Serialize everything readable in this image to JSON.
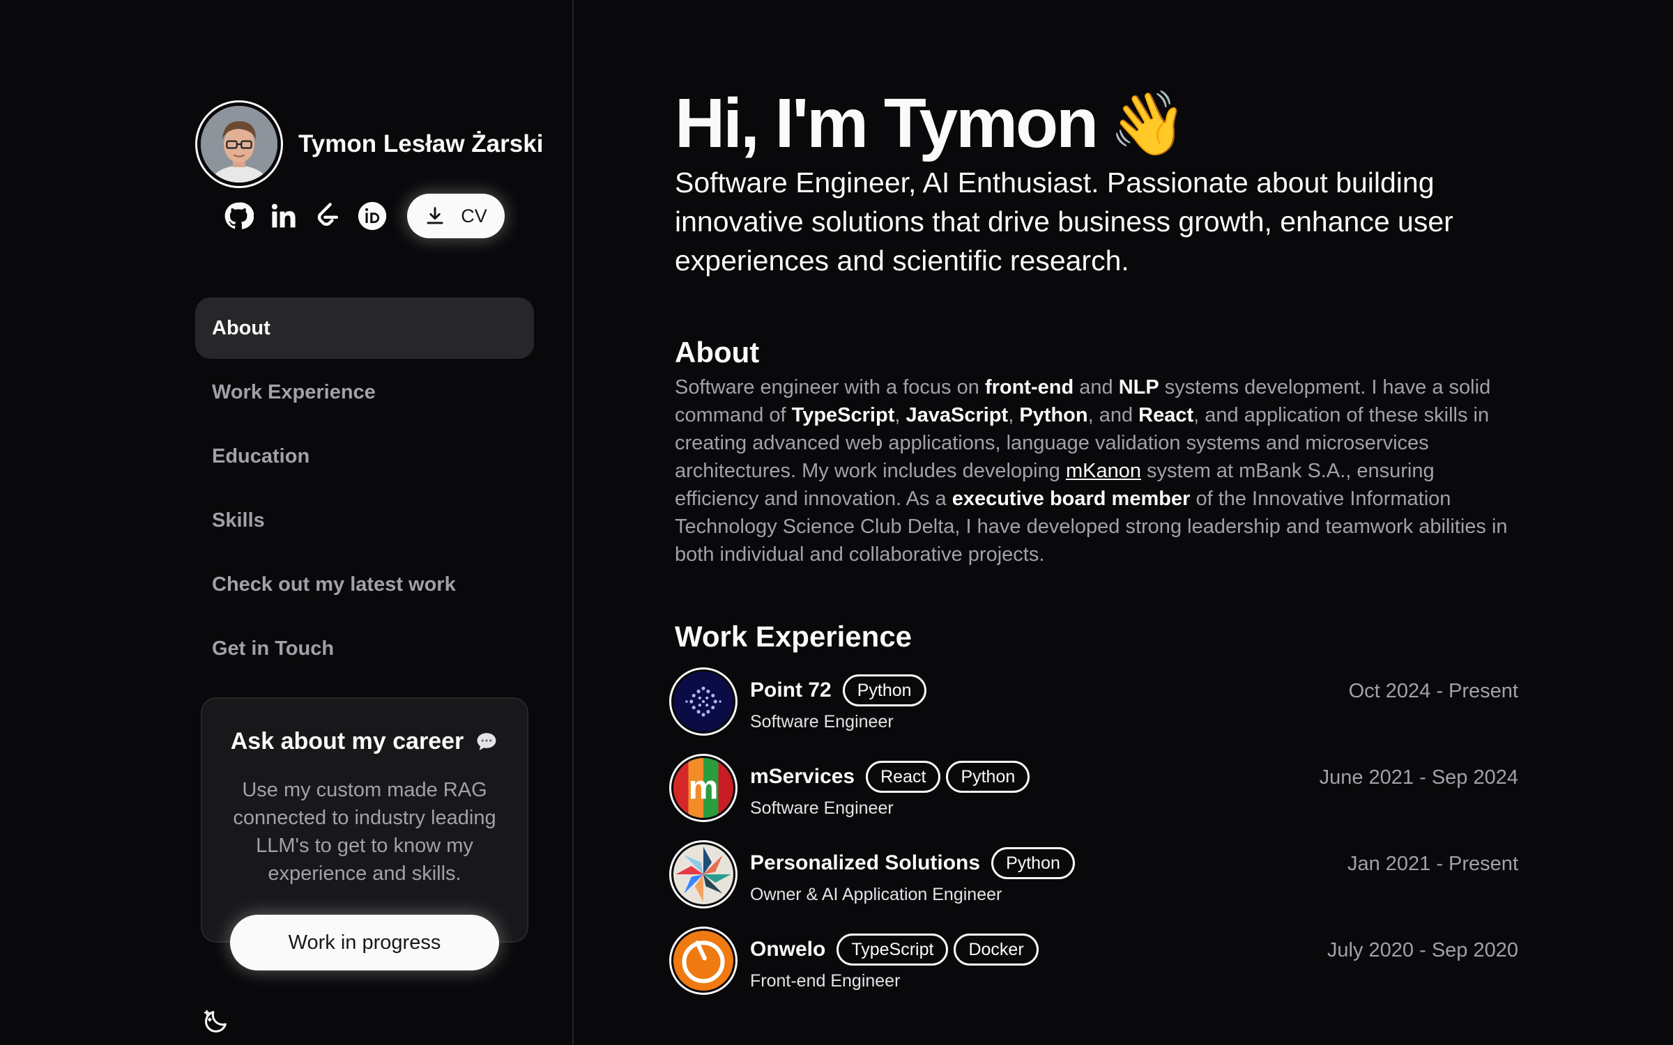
{
  "profile": {
    "name": "Tymon Lesław Żarski",
    "cv_label": "CV",
    "socials": [
      "github-icon",
      "linkedin-icon",
      "leetcode-icon",
      "orcid-icon"
    ]
  },
  "nav": {
    "items": [
      {
        "label": "About",
        "active": true
      },
      {
        "label": "Work Experience",
        "active": false
      },
      {
        "label": "Education",
        "active": false
      },
      {
        "label": "Skills",
        "active": false
      },
      {
        "label": "Check out my latest work",
        "active": false
      },
      {
        "label": "Get in Touch",
        "active": false
      }
    ]
  },
  "career_card": {
    "title": "Ask about my career",
    "text": "Use my custom made RAG connected to industry leading LLM's to get to know my experience and skills.",
    "button": "Work in progress"
  },
  "hero": {
    "title": "Hi, I'm Tymon",
    "wave": "👋",
    "subtitle": "Software Engineer, AI Enthusiast. Passionate about building innovative solutions that drive business growth, enhance user experiences and scientific research."
  },
  "about": {
    "heading": "About",
    "parts": [
      {
        "t": "Software engineer with a focus on "
      },
      {
        "t": "front-end",
        "b": true
      },
      {
        "t": " and "
      },
      {
        "t": "NLP",
        "b": true
      },
      {
        "t": " systems development. I have a solid command of "
      },
      {
        "t": "TypeScript",
        "b": true
      },
      {
        "t": ", "
      },
      {
        "t": "JavaScript",
        "b": true
      },
      {
        "t": ", "
      },
      {
        "t": "Python",
        "b": true
      },
      {
        "t": ", and "
      },
      {
        "t": "React",
        "b": true
      },
      {
        "t": ", and application of these skills in creating advanced web applications, language validation systems and microservices architectures. My work includes developing "
      },
      {
        "t": "mKanon",
        "link": true
      },
      {
        "t": " system at mBank S.A., ensuring efficiency and innovation. As a "
      },
      {
        "t": "executive board member",
        "b": true
      },
      {
        "t": " of the Innovative Information Technology Science Club Delta, I have developed strong leadership and teamwork abilities in both individual and collaborative projects."
      }
    ]
  },
  "work": {
    "heading": "Work Experience",
    "jobs": [
      {
        "company": "Point 72",
        "tags": [
          "Python"
        ],
        "role": "Software Engineer",
        "date": "Oct 2024  -  Present",
        "logo": "point72-logo"
      },
      {
        "company": "mServices",
        "tags": [
          "React",
          "Python"
        ],
        "role": "Software Engineer",
        "date": "June 2021  -  Sep 2024",
        "logo": "mservices-logo"
      },
      {
        "company": "Personalized Solutions",
        "tags": [
          "Python"
        ],
        "role": "Owner & AI Application Engineer",
        "date": "Jan 2021  -  Present",
        "logo": "personalized-solutions-logo"
      },
      {
        "company": "Onwelo",
        "tags": [
          "TypeScript",
          "Docker"
        ],
        "role": "Front-end Engineer",
        "date": "July 2020  -  Sep 2020",
        "logo": "onwelo-logo"
      }
    ]
  },
  "colors": {
    "background": "#09090b",
    "card": "#18181b",
    "muted_text": "#a1a1aa",
    "active_nav": "#27272a"
  }
}
